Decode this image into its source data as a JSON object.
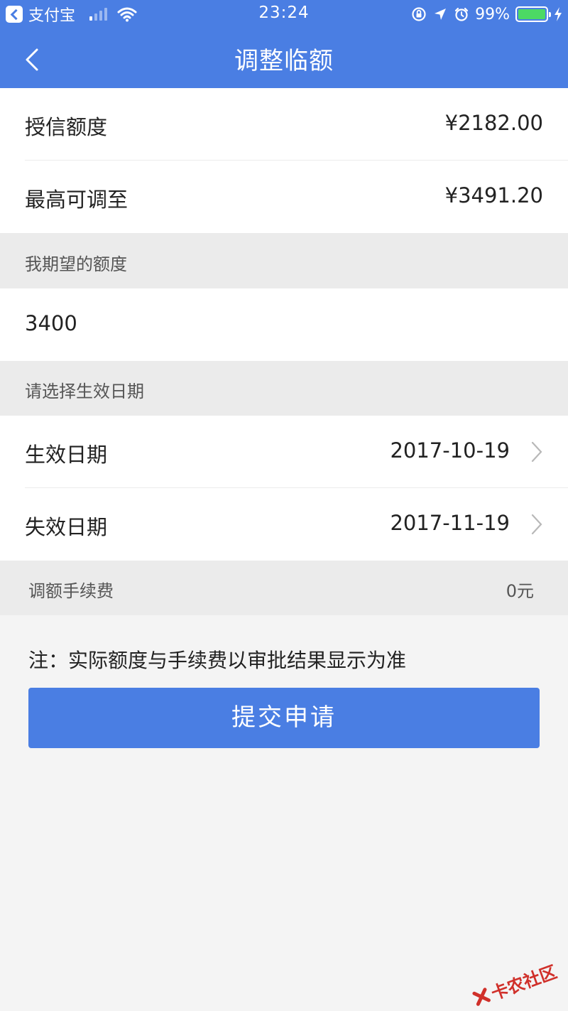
{
  "status_bar": {
    "back_app_label": "支付宝",
    "time": "23:24",
    "battery_percent": "99%",
    "signal_bars_on": 1,
    "signal_bars_total": 4,
    "battery_level": 0.99
  },
  "nav": {
    "title": "调整临额"
  },
  "credit": {
    "granted_label": "授信额度",
    "granted_value": "¥2182.00",
    "max_label": "最高可调至",
    "max_value": "¥3491.20"
  },
  "expected": {
    "section_label": "我期望的额度",
    "input_value": "3400"
  },
  "dates": {
    "section_label": "请选择生效日期",
    "effective_label": "生效日期",
    "effective_value": "2017-10-19",
    "expire_label": "失效日期",
    "expire_value": "2017-11-19"
  },
  "fee": {
    "label": "调额手续费",
    "value": "0元"
  },
  "note": "注：实际额度与手续费以审批结果显示为准",
  "submit_label": "提交申请",
  "watermark": "卡农社区",
  "colors": {
    "brand_blue": "#4a7ee3",
    "section_gray": "#ebebeb",
    "page_bg": "#f4f4f4",
    "battery_green": "#4cd964",
    "watermark_red": "#d0302a"
  }
}
